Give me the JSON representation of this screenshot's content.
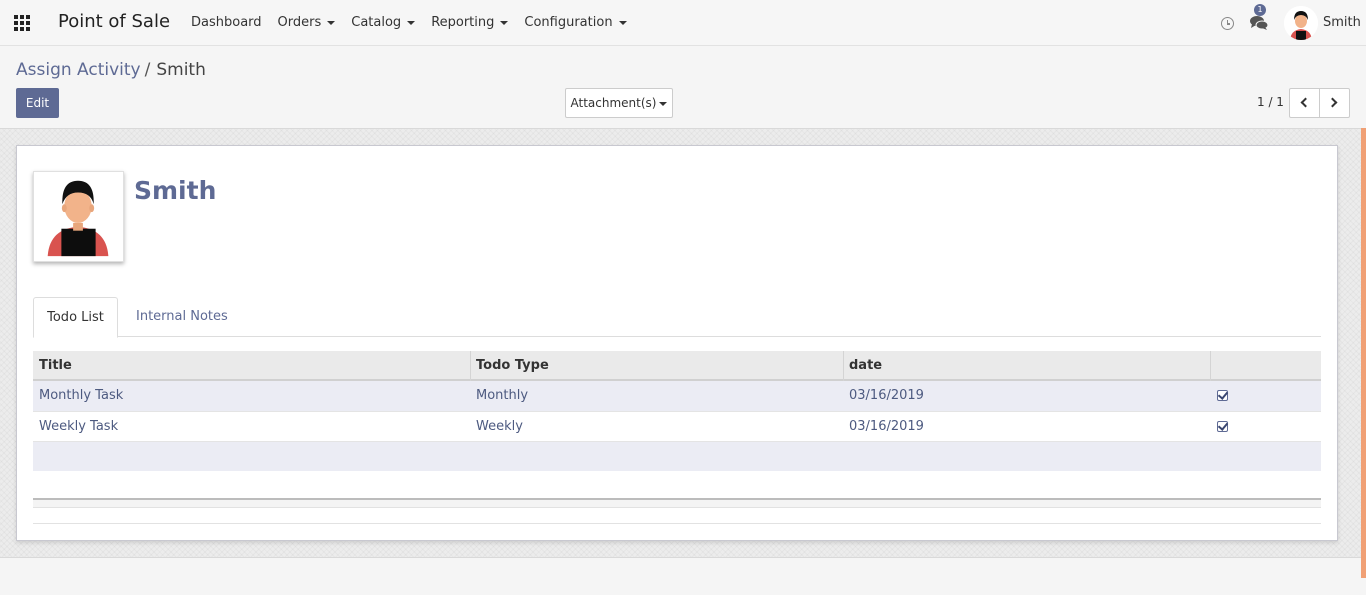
{
  "app": {
    "brand": "Point of Sale",
    "menu": [
      {
        "label": "Dashboard",
        "dropdown": false
      },
      {
        "label": "Orders",
        "dropdown": true
      },
      {
        "label": "Catalog",
        "dropdown": true
      },
      {
        "label": "Reporting",
        "dropdown": true
      },
      {
        "label": "Configuration",
        "dropdown": true
      }
    ],
    "chat_badge": "1",
    "user_name": "Smith"
  },
  "breadcrumb": {
    "parent": "Assign Activity",
    "separator": "/",
    "current": "Smith"
  },
  "toolbar": {
    "edit_label": "Edit",
    "attachments_label": "Attachment(s)",
    "pager": "1 / 1"
  },
  "record": {
    "name": "Smith"
  },
  "tabs": [
    {
      "label": "Todo List",
      "active": true
    },
    {
      "label": "Internal Notes",
      "active": false
    }
  ],
  "table": {
    "columns": [
      "Title",
      "Todo Type",
      "date",
      ""
    ],
    "rows": [
      {
        "title": "Monthly Task",
        "type": "Monthly",
        "date": "03/16/2019",
        "done": true
      },
      {
        "title": "Weekly Task",
        "type": "Weekly",
        "date": "03/16/2019",
        "done": true
      }
    ]
  },
  "colors": {
    "primary": "#5e6a94",
    "accent_scrollbar": "#f0a075"
  },
  "icons": [
    "apps-grid-icon",
    "clock-icon",
    "chat-icon",
    "chevron-left-icon",
    "chevron-right-icon",
    "checkbox-checked-icon"
  ]
}
